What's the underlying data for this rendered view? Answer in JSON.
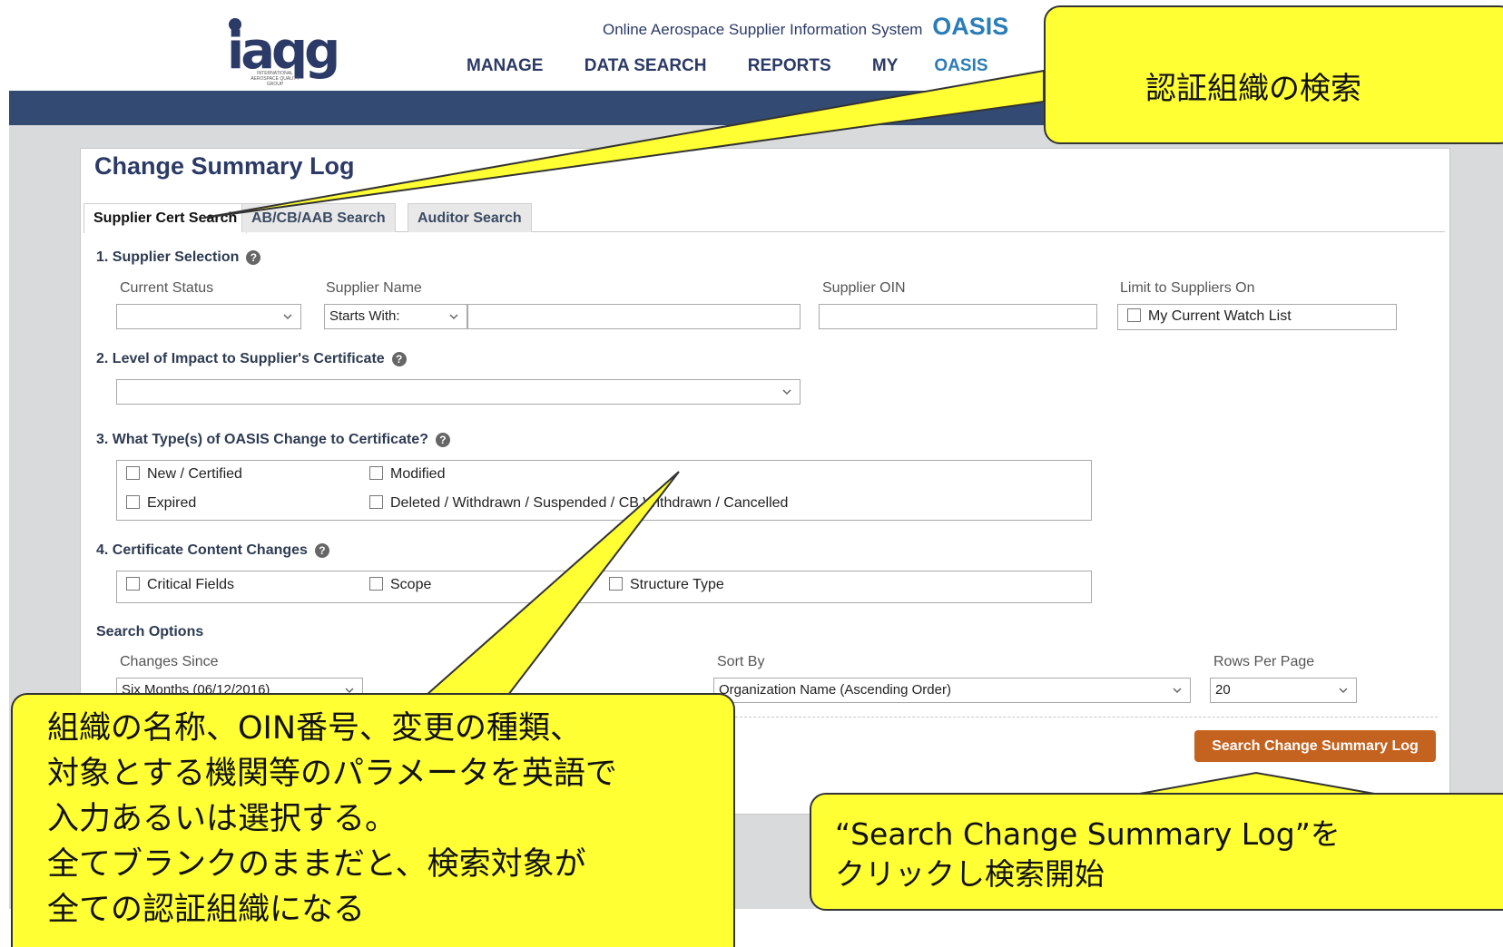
{
  "header": {
    "logo_text": "iaqg",
    "logo_sub": "INTERNATIONAL AEROSPACE QUALITY GROUP",
    "system_label": "Online Aerospace Supplier Information System",
    "system_brand": "OASIS",
    "nav": {
      "manage": "MANAGE",
      "data_search": "DATA SEARCH",
      "reports": "REPORTS",
      "my_prefix": "MY",
      "my_suffix": "OASIS"
    }
  },
  "page": {
    "title": "Change Summary Log",
    "tabs": [
      {
        "label": "Supplier Cert Search",
        "active": true
      },
      {
        "label": "AB/CB/AAB Search",
        "active": false
      },
      {
        "label": "Auditor Search",
        "active": false
      }
    ]
  },
  "section1": {
    "label": "1. Supplier Selection",
    "current_status_label": "Current Status",
    "current_status_value": "",
    "supplier_name_label": "Supplier Name",
    "supplier_name_mode": "Starts With:",
    "supplier_name_value": "",
    "supplier_oin_label": "Supplier OIN",
    "supplier_oin_value": "",
    "limit_label": "Limit to Suppliers On",
    "watch_list": "My Current Watch List"
  },
  "section2": {
    "label": "2. Level of Impact to Supplier's Certificate",
    "value": ""
  },
  "section3": {
    "label": "3. What Type(s) of OASIS Change to Certificate?",
    "options": [
      "New / Certified",
      "Modified",
      "Expired",
      "Deleted / Withdrawn / Suspended / CB Withdrawn / Cancelled"
    ]
  },
  "section4": {
    "label": "4. Certificate Content Changes",
    "options": [
      "Critical Fields",
      "Scope",
      "Structure Type"
    ]
  },
  "search_options": {
    "label": "Search Options",
    "changes_since_label": "Changes Since",
    "changes_since_value": "Six Months (06/12/2016)",
    "sort_by_label": "Sort By",
    "sort_by_value": "Organization Name (Ascending Order)",
    "rows_per_page_label": "Rows Per Page",
    "rows_per_page_value": "20",
    "search_button": "Search Change Summary Log"
  },
  "callouts": {
    "top": "認証組織の検索",
    "left": [
      "組織の名称、OIN番号、変更の種類、",
      "対象とする機関等のパラメータを英語で",
      "入力あるいは選択する。",
      "全てブランクのままだと、検索対象が",
      "全ての認証組織になる"
    ],
    "right": [
      "“Search Change Summary Log”を",
      "クリックし検索開始"
    ]
  },
  "colors": {
    "navy": "#2b3a66",
    "accent_blue": "#2a7db8",
    "band": "#334b72",
    "button": "#c4621f",
    "callout": "#ffff33"
  }
}
